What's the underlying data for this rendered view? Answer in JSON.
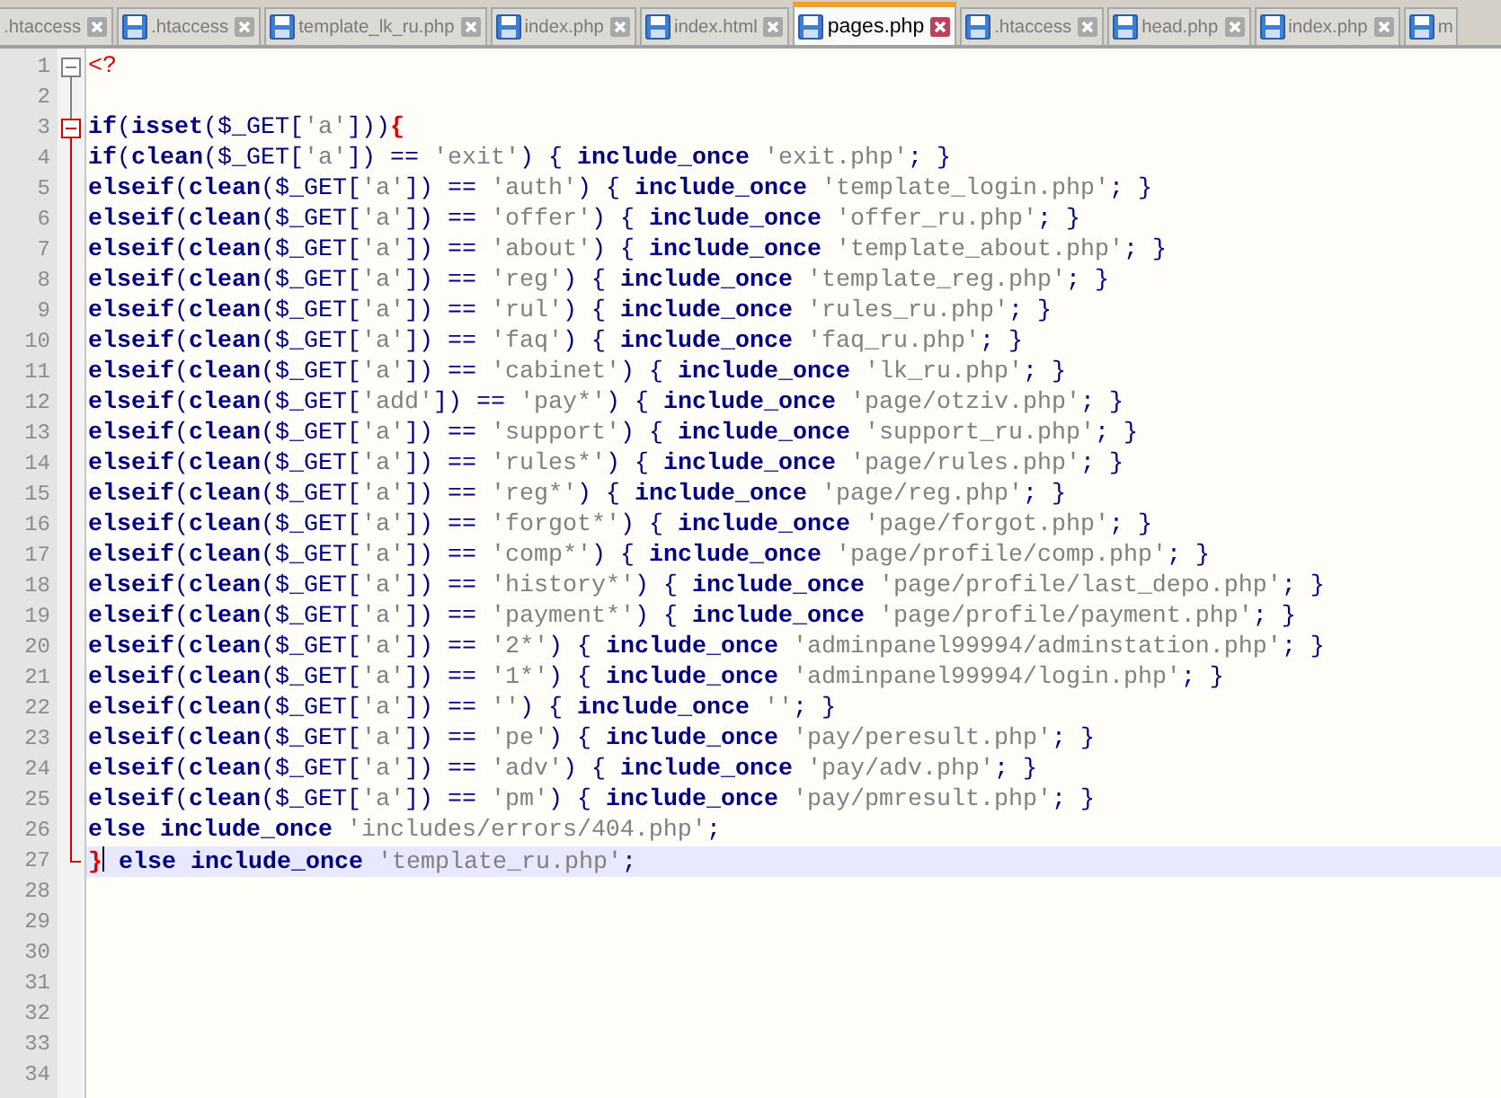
{
  "tabs": [
    {
      "label": ".htaccess",
      "selected": false,
      "icon": false,
      "close": true
    },
    {
      "label": ".htaccess",
      "selected": false,
      "icon": true,
      "close": true
    },
    {
      "label": "template_lk_ru.php",
      "selected": false,
      "icon": true,
      "close": true
    },
    {
      "label": "index.php",
      "selected": false,
      "icon": true,
      "close": true
    },
    {
      "label": "index.html",
      "selected": false,
      "icon": true,
      "close": true
    },
    {
      "label": "pages.php",
      "selected": true,
      "icon": true,
      "close": true
    },
    {
      "label": ".htaccess",
      "selected": false,
      "icon": true,
      "close": true
    },
    {
      "label": "head.php",
      "selected": false,
      "icon": true,
      "close": true
    },
    {
      "label": "index.php",
      "selected": false,
      "icon": true,
      "close": true
    },
    {
      "label": "m",
      "selected": false,
      "icon": true,
      "close": false
    }
  ],
  "lines": [
    {
      "number": "1",
      "fold": {
        "kind": "start",
        "active": false
      },
      "current": false,
      "tokens": [
        {
          "kind": "php",
          "text": "<?"
        }
      ]
    },
    {
      "number": "2",
      "fold": {
        "kind": "line",
        "active": false
      },
      "current": false
    },
    {
      "number": "3",
      "fold": {
        "kind": "start",
        "active": true
      },
      "current": false,
      "tokens": [
        {
          "kind": "kw",
          "text": "if"
        },
        {
          "kind": "op",
          "text": "("
        },
        {
          "kind": "kw",
          "text": "isset"
        },
        {
          "kind": "op",
          "text": "($_GET["
        },
        {
          "kind": "str",
          "text": "'a'"
        },
        {
          "kind": "op",
          "text": "]))"
        },
        {
          "kind": "brace",
          "text": "{"
        }
      ]
    },
    {
      "number": "4",
      "fold": {
        "kind": "line",
        "active": true
      },
      "current": false,
      "tokens": [
        {
          "kind": "kw",
          "text": "if"
        },
        {
          "kind": "op",
          "text": "("
        },
        {
          "kind": "kw",
          "text": "clean"
        },
        {
          "kind": "op",
          "text": "($_GET["
        },
        {
          "kind": "str",
          "text": "'a'"
        },
        {
          "kind": "op",
          "text": "]) == "
        },
        {
          "kind": "str",
          "text": "'exit'"
        },
        {
          "kind": "op",
          "text": ") { "
        },
        {
          "kind": "kw",
          "text": "include_once "
        },
        {
          "kind": "str",
          "text": "'exit.php'"
        },
        {
          "kind": "op",
          "text": "; }"
        }
      ]
    },
    {
      "number": "5",
      "fold": {
        "kind": "line",
        "active": true
      },
      "current": false,
      "tokens": [
        {
          "kind": "kw",
          "text": "elseif"
        },
        {
          "kind": "op",
          "text": "("
        },
        {
          "kind": "kw",
          "text": "clean"
        },
        {
          "kind": "op",
          "text": "($_GET["
        },
        {
          "kind": "str",
          "text": "'a'"
        },
        {
          "kind": "op",
          "text": "]) == "
        },
        {
          "kind": "str",
          "text": "'auth'"
        },
        {
          "kind": "op",
          "text": ") { "
        },
        {
          "kind": "kw",
          "text": "include_once "
        },
        {
          "kind": "str",
          "text": "'template_login.php'"
        },
        {
          "kind": "op",
          "text": "; }"
        }
      ]
    },
    {
      "number": "6",
      "fold": {
        "kind": "line",
        "active": true
      },
      "current": false,
      "tokens": [
        {
          "kind": "kw",
          "text": "elseif"
        },
        {
          "kind": "op",
          "text": "("
        },
        {
          "kind": "kw",
          "text": "clean"
        },
        {
          "kind": "op",
          "text": "($_GET["
        },
        {
          "kind": "str",
          "text": "'a'"
        },
        {
          "kind": "op",
          "text": "]) == "
        },
        {
          "kind": "str",
          "text": "'offer'"
        },
        {
          "kind": "op",
          "text": ") { "
        },
        {
          "kind": "kw",
          "text": "include_once "
        },
        {
          "kind": "str",
          "text": "'offer_ru.php'"
        },
        {
          "kind": "op",
          "text": "; }"
        }
      ]
    },
    {
      "number": "7",
      "fold": {
        "kind": "line",
        "active": true
      },
      "current": false,
      "tokens": [
        {
          "kind": "kw",
          "text": "elseif"
        },
        {
          "kind": "op",
          "text": "("
        },
        {
          "kind": "kw",
          "text": "clean"
        },
        {
          "kind": "op",
          "text": "($_GET["
        },
        {
          "kind": "str",
          "text": "'a'"
        },
        {
          "kind": "op",
          "text": "]) == "
        },
        {
          "kind": "str",
          "text": "'about'"
        },
        {
          "kind": "op",
          "text": ") { "
        },
        {
          "kind": "kw",
          "text": "include_once "
        },
        {
          "kind": "str",
          "text": "'template_about.php'"
        },
        {
          "kind": "op",
          "text": "; }"
        }
      ]
    },
    {
      "number": "8",
      "fold": {
        "kind": "line",
        "active": true
      },
      "current": false,
      "tokens": [
        {
          "kind": "kw",
          "text": "elseif"
        },
        {
          "kind": "op",
          "text": "("
        },
        {
          "kind": "kw",
          "text": "clean"
        },
        {
          "kind": "op",
          "text": "($_GET["
        },
        {
          "kind": "str",
          "text": "'a'"
        },
        {
          "kind": "op",
          "text": "]) == "
        },
        {
          "kind": "str",
          "text": "'reg'"
        },
        {
          "kind": "op",
          "text": ") { "
        },
        {
          "kind": "kw",
          "text": "include_once "
        },
        {
          "kind": "str",
          "text": "'template_reg.php'"
        },
        {
          "kind": "op",
          "text": "; }"
        }
      ]
    },
    {
      "number": "9",
      "fold": {
        "kind": "line",
        "active": true
      },
      "current": false,
      "tokens": [
        {
          "kind": "kw",
          "text": "elseif"
        },
        {
          "kind": "op",
          "text": "("
        },
        {
          "kind": "kw",
          "text": "clean"
        },
        {
          "kind": "op",
          "text": "($_GET["
        },
        {
          "kind": "str",
          "text": "'a'"
        },
        {
          "kind": "op",
          "text": "]) == "
        },
        {
          "kind": "str",
          "text": "'rul'"
        },
        {
          "kind": "op",
          "text": ") { "
        },
        {
          "kind": "kw",
          "text": "include_once "
        },
        {
          "kind": "str",
          "text": "'rules_ru.php'"
        },
        {
          "kind": "op",
          "text": "; }"
        }
      ]
    },
    {
      "number": "10",
      "fold": {
        "kind": "line",
        "active": true
      },
      "current": false,
      "tokens": [
        {
          "kind": "kw",
          "text": "elseif"
        },
        {
          "kind": "op",
          "text": "("
        },
        {
          "kind": "kw",
          "text": "clean"
        },
        {
          "kind": "op",
          "text": "($_GET["
        },
        {
          "kind": "str",
          "text": "'a'"
        },
        {
          "kind": "op",
          "text": "]) == "
        },
        {
          "kind": "str",
          "text": "'faq'"
        },
        {
          "kind": "op",
          "text": ") { "
        },
        {
          "kind": "kw",
          "text": "include_once "
        },
        {
          "kind": "str",
          "text": "'faq_ru.php'"
        },
        {
          "kind": "op",
          "text": "; }"
        }
      ]
    },
    {
      "number": "11",
      "fold": {
        "kind": "line",
        "active": true
      },
      "current": false,
      "tokens": [
        {
          "kind": "kw",
          "text": "elseif"
        },
        {
          "kind": "op",
          "text": "("
        },
        {
          "kind": "kw",
          "text": "clean"
        },
        {
          "kind": "op",
          "text": "($_GET["
        },
        {
          "kind": "str",
          "text": "'a'"
        },
        {
          "kind": "op",
          "text": "]) == "
        },
        {
          "kind": "str",
          "text": "'cabinet'"
        },
        {
          "kind": "op",
          "text": ") { "
        },
        {
          "kind": "kw",
          "text": "include_once "
        },
        {
          "kind": "str",
          "text": "'lk_ru.php'"
        },
        {
          "kind": "op",
          "text": "; }"
        }
      ]
    },
    {
      "number": "12",
      "fold": {
        "kind": "line",
        "active": true
      },
      "current": false,
      "tokens": [
        {
          "kind": "kw",
          "text": "elseif"
        },
        {
          "kind": "op",
          "text": "("
        },
        {
          "kind": "kw",
          "text": "clean"
        },
        {
          "kind": "op",
          "text": "($_GET["
        },
        {
          "kind": "str",
          "text": "'add'"
        },
        {
          "kind": "op",
          "text": "]) == "
        },
        {
          "kind": "str",
          "text": "'pay*'"
        },
        {
          "kind": "op",
          "text": ") { "
        },
        {
          "kind": "kw",
          "text": "include_once "
        },
        {
          "kind": "str",
          "text": "'page/otziv.php'"
        },
        {
          "kind": "op",
          "text": "; }"
        }
      ]
    },
    {
      "number": "13",
      "fold": {
        "kind": "line",
        "active": true
      },
      "current": false,
      "tokens": [
        {
          "kind": "kw",
          "text": "elseif"
        },
        {
          "kind": "op",
          "text": "("
        },
        {
          "kind": "kw",
          "text": "clean"
        },
        {
          "kind": "op",
          "text": "($_GET["
        },
        {
          "kind": "str",
          "text": "'a'"
        },
        {
          "kind": "op",
          "text": "]) == "
        },
        {
          "kind": "str",
          "text": "'support'"
        },
        {
          "kind": "op",
          "text": ") { "
        },
        {
          "kind": "kw",
          "text": "include_once "
        },
        {
          "kind": "str",
          "text": "'support_ru.php'"
        },
        {
          "kind": "op",
          "text": "; }"
        }
      ]
    },
    {
      "number": "14",
      "fold": {
        "kind": "line",
        "active": true
      },
      "current": false,
      "tokens": [
        {
          "kind": "kw",
          "text": "elseif"
        },
        {
          "kind": "op",
          "text": "("
        },
        {
          "kind": "kw",
          "text": "clean"
        },
        {
          "kind": "op",
          "text": "($_GET["
        },
        {
          "kind": "str",
          "text": "'a'"
        },
        {
          "kind": "op",
          "text": "]) == "
        },
        {
          "kind": "str",
          "text": "'rules*'"
        },
        {
          "kind": "op",
          "text": ") { "
        },
        {
          "kind": "kw",
          "text": "include_once "
        },
        {
          "kind": "str",
          "text": "'page/rules.php'"
        },
        {
          "kind": "op",
          "text": "; }"
        }
      ]
    },
    {
      "number": "15",
      "fold": {
        "kind": "line",
        "active": true
      },
      "current": false,
      "tokens": [
        {
          "kind": "kw",
          "text": "elseif"
        },
        {
          "kind": "op",
          "text": "("
        },
        {
          "kind": "kw",
          "text": "clean"
        },
        {
          "kind": "op",
          "text": "($_GET["
        },
        {
          "kind": "str",
          "text": "'a'"
        },
        {
          "kind": "op",
          "text": "]) == "
        },
        {
          "kind": "str",
          "text": "'reg*'"
        },
        {
          "kind": "op",
          "text": ") { "
        },
        {
          "kind": "kw",
          "text": "include_once "
        },
        {
          "kind": "str",
          "text": "'page/reg.php'"
        },
        {
          "kind": "op",
          "text": "; }"
        }
      ]
    },
    {
      "number": "16",
      "fold": {
        "kind": "line",
        "active": true
      },
      "current": false,
      "tokens": [
        {
          "kind": "kw",
          "text": "elseif"
        },
        {
          "kind": "op",
          "text": "("
        },
        {
          "kind": "kw",
          "text": "clean"
        },
        {
          "kind": "op",
          "text": "($_GET["
        },
        {
          "kind": "str",
          "text": "'a'"
        },
        {
          "kind": "op",
          "text": "]) == "
        },
        {
          "kind": "str",
          "text": "'forgot*'"
        },
        {
          "kind": "op",
          "text": ") { "
        },
        {
          "kind": "kw",
          "text": "include_once "
        },
        {
          "kind": "str",
          "text": "'page/forgot.php'"
        },
        {
          "kind": "op",
          "text": "; }"
        }
      ]
    },
    {
      "number": "17",
      "fold": {
        "kind": "line",
        "active": true
      },
      "current": false,
      "tokens": [
        {
          "kind": "kw",
          "text": "elseif"
        },
        {
          "kind": "op",
          "text": "("
        },
        {
          "kind": "kw",
          "text": "clean"
        },
        {
          "kind": "op",
          "text": "($_GET["
        },
        {
          "kind": "str",
          "text": "'a'"
        },
        {
          "kind": "op",
          "text": "]) == "
        },
        {
          "kind": "str",
          "text": "'comp*'"
        },
        {
          "kind": "op",
          "text": ") { "
        },
        {
          "kind": "kw",
          "text": "include_once "
        },
        {
          "kind": "str",
          "text": "'page/profile/comp.php'"
        },
        {
          "kind": "op",
          "text": "; }"
        }
      ]
    },
    {
      "number": "18",
      "fold": {
        "kind": "line",
        "active": true
      },
      "current": false,
      "tokens": [
        {
          "kind": "kw",
          "text": "elseif"
        },
        {
          "kind": "op",
          "text": "("
        },
        {
          "kind": "kw",
          "text": "clean"
        },
        {
          "kind": "op",
          "text": "($_GET["
        },
        {
          "kind": "str",
          "text": "'a'"
        },
        {
          "kind": "op",
          "text": "]) == "
        },
        {
          "kind": "str",
          "text": "'history*'"
        },
        {
          "kind": "op",
          "text": ") { "
        },
        {
          "kind": "kw",
          "text": "include_once "
        },
        {
          "kind": "str",
          "text": "'page/profile/last_depo.php'"
        },
        {
          "kind": "op",
          "text": "; }"
        }
      ]
    },
    {
      "number": "19",
      "fold": {
        "kind": "line",
        "active": true
      },
      "current": false,
      "tokens": [
        {
          "kind": "kw",
          "text": "elseif"
        },
        {
          "kind": "op",
          "text": "("
        },
        {
          "kind": "kw",
          "text": "clean"
        },
        {
          "kind": "op",
          "text": "($_GET["
        },
        {
          "kind": "str",
          "text": "'a'"
        },
        {
          "kind": "op",
          "text": "]) == "
        },
        {
          "kind": "str",
          "text": "'payment*'"
        },
        {
          "kind": "op",
          "text": ") { "
        },
        {
          "kind": "kw",
          "text": "include_once "
        },
        {
          "kind": "str",
          "text": "'page/profile/payment.php'"
        },
        {
          "kind": "op",
          "text": "; }"
        }
      ]
    },
    {
      "number": "20",
      "fold": {
        "kind": "line",
        "active": true
      },
      "current": false,
      "tokens": [
        {
          "kind": "kw",
          "text": "elseif"
        },
        {
          "kind": "op",
          "text": "("
        },
        {
          "kind": "kw",
          "text": "clean"
        },
        {
          "kind": "op",
          "text": "($_GET["
        },
        {
          "kind": "str",
          "text": "'a'"
        },
        {
          "kind": "op",
          "text": "]) == "
        },
        {
          "kind": "str",
          "text": "'2*'"
        },
        {
          "kind": "op",
          "text": ") { "
        },
        {
          "kind": "kw",
          "text": "include_once "
        },
        {
          "kind": "str",
          "text": "'adminpanel99994/adminstation.php'"
        },
        {
          "kind": "op",
          "text": "; }"
        }
      ]
    },
    {
      "number": "21",
      "fold": {
        "kind": "line",
        "active": true
      },
      "current": false,
      "tokens": [
        {
          "kind": "kw",
          "text": "elseif"
        },
        {
          "kind": "op",
          "text": "("
        },
        {
          "kind": "kw",
          "text": "clean"
        },
        {
          "kind": "op",
          "text": "($_GET["
        },
        {
          "kind": "str",
          "text": "'a'"
        },
        {
          "kind": "op",
          "text": "]) == "
        },
        {
          "kind": "str",
          "text": "'1*'"
        },
        {
          "kind": "op",
          "text": ") { "
        },
        {
          "kind": "kw",
          "text": "include_once "
        },
        {
          "kind": "str",
          "text": "'adminpanel99994/login.php'"
        },
        {
          "kind": "op",
          "text": "; }"
        }
      ]
    },
    {
      "number": "22",
      "fold": {
        "kind": "line",
        "active": true
      },
      "current": false,
      "tokens": [
        {
          "kind": "kw",
          "text": "elseif"
        },
        {
          "kind": "op",
          "text": "("
        },
        {
          "kind": "kw",
          "text": "clean"
        },
        {
          "kind": "op",
          "text": "($_GET["
        },
        {
          "kind": "str",
          "text": "'a'"
        },
        {
          "kind": "op",
          "text": "]) == "
        },
        {
          "kind": "str",
          "text": "''"
        },
        {
          "kind": "op",
          "text": ") { "
        },
        {
          "kind": "kw",
          "text": "include_once "
        },
        {
          "kind": "str",
          "text": "''"
        },
        {
          "kind": "op",
          "text": "; }"
        }
      ]
    },
    {
      "number": "23",
      "fold": {
        "kind": "line",
        "active": true
      },
      "current": false,
      "tokens": [
        {
          "kind": "kw",
          "text": "elseif"
        },
        {
          "kind": "op",
          "text": "("
        },
        {
          "kind": "kw",
          "text": "clean"
        },
        {
          "kind": "op",
          "text": "($_GET["
        },
        {
          "kind": "str",
          "text": "'a'"
        },
        {
          "kind": "op",
          "text": "]) == "
        },
        {
          "kind": "str",
          "text": "'pe'"
        },
        {
          "kind": "op",
          "text": ") { "
        },
        {
          "kind": "kw",
          "text": "include_once "
        },
        {
          "kind": "str",
          "text": "'pay/peresult.php'"
        },
        {
          "kind": "op",
          "text": "; }"
        }
      ]
    },
    {
      "number": "24",
      "fold": {
        "kind": "line",
        "active": true
      },
      "current": false,
      "tokens": [
        {
          "kind": "kw",
          "text": "elseif"
        },
        {
          "kind": "op",
          "text": "("
        },
        {
          "kind": "kw",
          "text": "clean"
        },
        {
          "kind": "op",
          "text": "($_GET["
        },
        {
          "kind": "str",
          "text": "'a'"
        },
        {
          "kind": "op",
          "text": "]) == "
        },
        {
          "kind": "str",
          "text": "'adv'"
        },
        {
          "kind": "op",
          "text": ") { "
        },
        {
          "kind": "kw",
          "text": "include_once "
        },
        {
          "kind": "str",
          "text": "'pay/adv.php'"
        },
        {
          "kind": "op",
          "text": "; }"
        }
      ]
    },
    {
      "number": "25",
      "fold": {
        "kind": "line",
        "active": true
      },
      "current": false,
      "tokens": [
        {
          "kind": "kw",
          "text": "elseif"
        },
        {
          "kind": "op",
          "text": "("
        },
        {
          "kind": "kw",
          "text": "clean"
        },
        {
          "kind": "op",
          "text": "($_GET["
        },
        {
          "kind": "str",
          "text": "'a'"
        },
        {
          "kind": "op",
          "text": "]) == "
        },
        {
          "kind": "str",
          "text": "'pm'"
        },
        {
          "kind": "op",
          "text": ") { "
        },
        {
          "kind": "kw",
          "text": "include_once "
        },
        {
          "kind": "str",
          "text": "'pay/pmresult.php'"
        },
        {
          "kind": "op",
          "text": "; }"
        }
      ]
    },
    {
      "number": "26",
      "fold": {
        "kind": "line",
        "active": true
      },
      "current": false,
      "tokens": [
        {
          "kind": "kw",
          "text": "else include_once "
        },
        {
          "kind": "str",
          "text": "'includes/errors/404.php'"
        },
        {
          "kind": "op",
          "text": ";"
        }
      ]
    },
    {
      "number": "27",
      "fold": {
        "kind": "end",
        "active": true
      },
      "current": true,
      "tokens": [
        {
          "kind": "brace",
          "text": "}"
        },
        {
          "kind": "kw",
          "text": " else include_once "
        },
        {
          "kind": "str",
          "text": "'template_ru.php'"
        },
        {
          "kind": "op",
          "text": ";"
        }
      ]
    },
    {
      "number": "28",
      "current": false
    },
    {
      "number": "29",
      "current": false
    },
    {
      "number": "30",
      "current": false
    },
    {
      "number": "31",
      "current": false
    },
    {
      "number": "32",
      "current": false
    },
    {
      "number": "33",
      "current": false
    },
    {
      "number": "34",
      "current": false
    }
  ]
}
